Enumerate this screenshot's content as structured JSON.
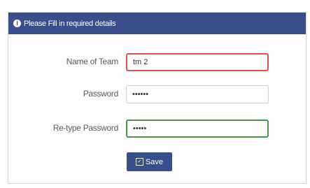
{
  "header": {
    "icon": "info-icon",
    "message": "Please Fill in required details"
  },
  "form": {
    "team": {
      "label": "Name of Team",
      "value": "tm 2",
      "state": "error",
      "state_color": "#d9534f"
    },
    "password": {
      "label": "Password",
      "value": "••••••"
    },
    "retype": {
      "label": "Re-type Password",
      "value": "•••••",
      "state": "success",
      "state_color": "#3c9f3c"
    }
  },
  "save": {
    "label": "Save",
    "icon": "checkbox-icon"
  },
  "colors": {
    "accent": "#3a4e8c"
  }
}
